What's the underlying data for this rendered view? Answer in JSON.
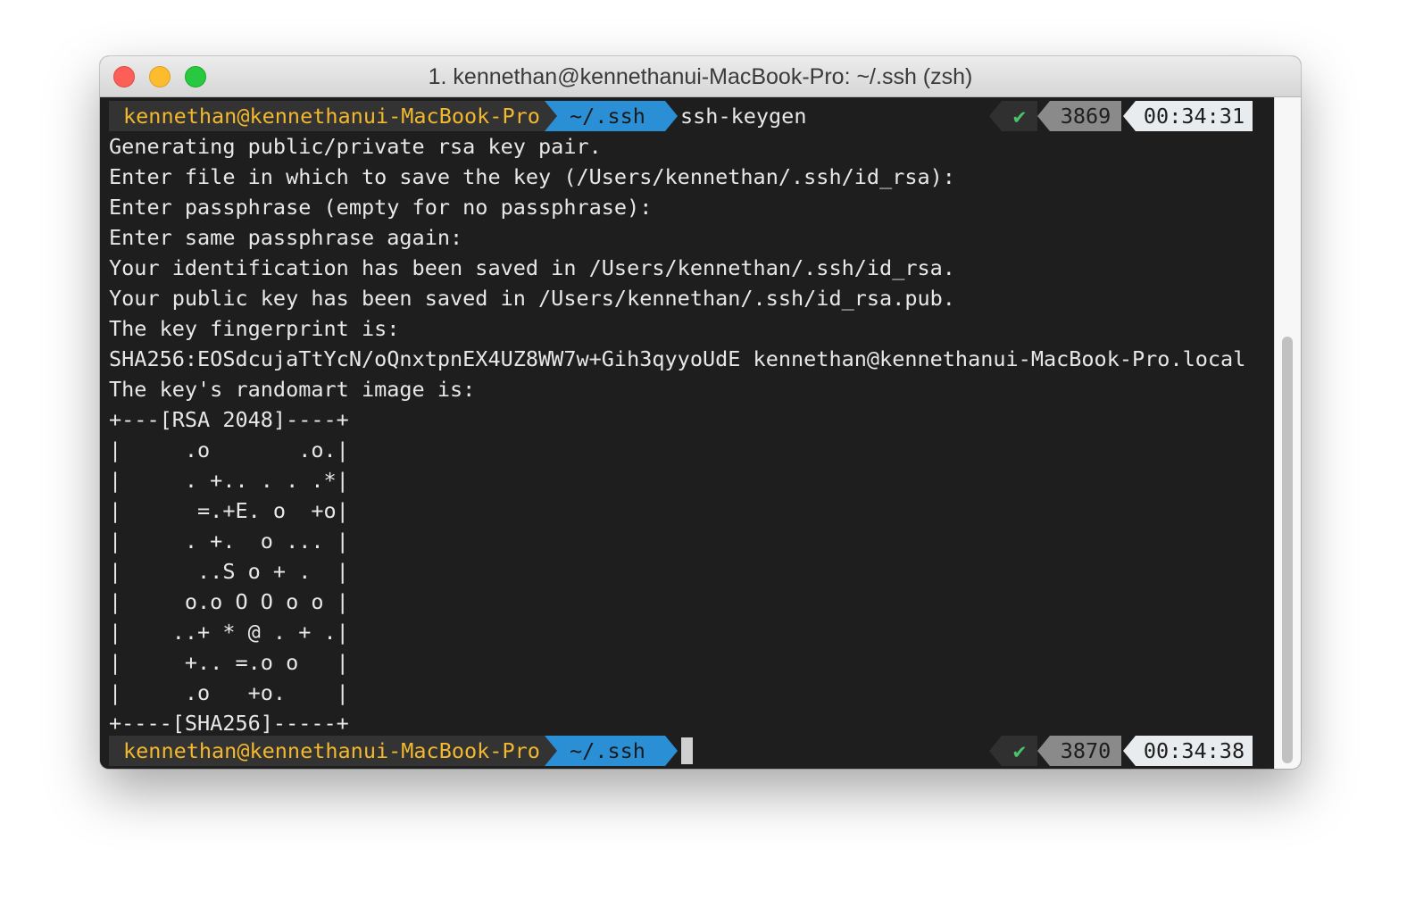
{
  "window": {
    "title": "1. kennethan@kennethanui-MacBook-Pro: ~/.ssh (zsh)"
  },
  "prompt1": {
    "user": "kennethan@kennethanui-MacBook-Pro",
    "dir": "~/.ssh",
    "command": "ssh-keygen",
    "status": "✔",
    "history": "3869",
    "time": "00:34:31"
  },
  "output": [
    "Generating public/private rsa key pair.",
    "Enter file in which to save the key (/Users/kennethan/.ssh/id_rsa):",
    "Enter passphrase (empty for no passphrase):",
    "Enter same passphrase again:",
    "Your identification has been saved in /Users/kennethan/.ssh/id_rsa.",
    "Your public key has been saved in /Users/kennethan/.ssh/id_rsa.pub.",
    "The key fingerprint is:",
    "SHA256:EOSdcujaTtYcN/oQnxtpnEX4UZ8WW7w+Gih3qyyoUdE kennethan@kennethanui-MacBook-Pro.local",
    "The key's randomart image is:",
    "+---[RSA 2048]----+",
    "|     .o       .o.|",
    "|     . +.. . . .*|",
    "|      =.+E. o  +o|",
    "|     . +.  o ... |",
    "|      ..S o + .  |",
    "|     o.o O O o o |",
    "|    ..+ * @ . + .|",
    "|     +.. =.o o   |",
    "|     .o   +o.    |",
    "+----[SHA256]-----+"
  ],
  "prompt2": {
    "user": "kennethan@kennethanui-MacBook-Pro",
    "dir": "~/.ssh",
    "status": "✔",
    "history": "3870",
    "time": "00:34:38"
  }
}
